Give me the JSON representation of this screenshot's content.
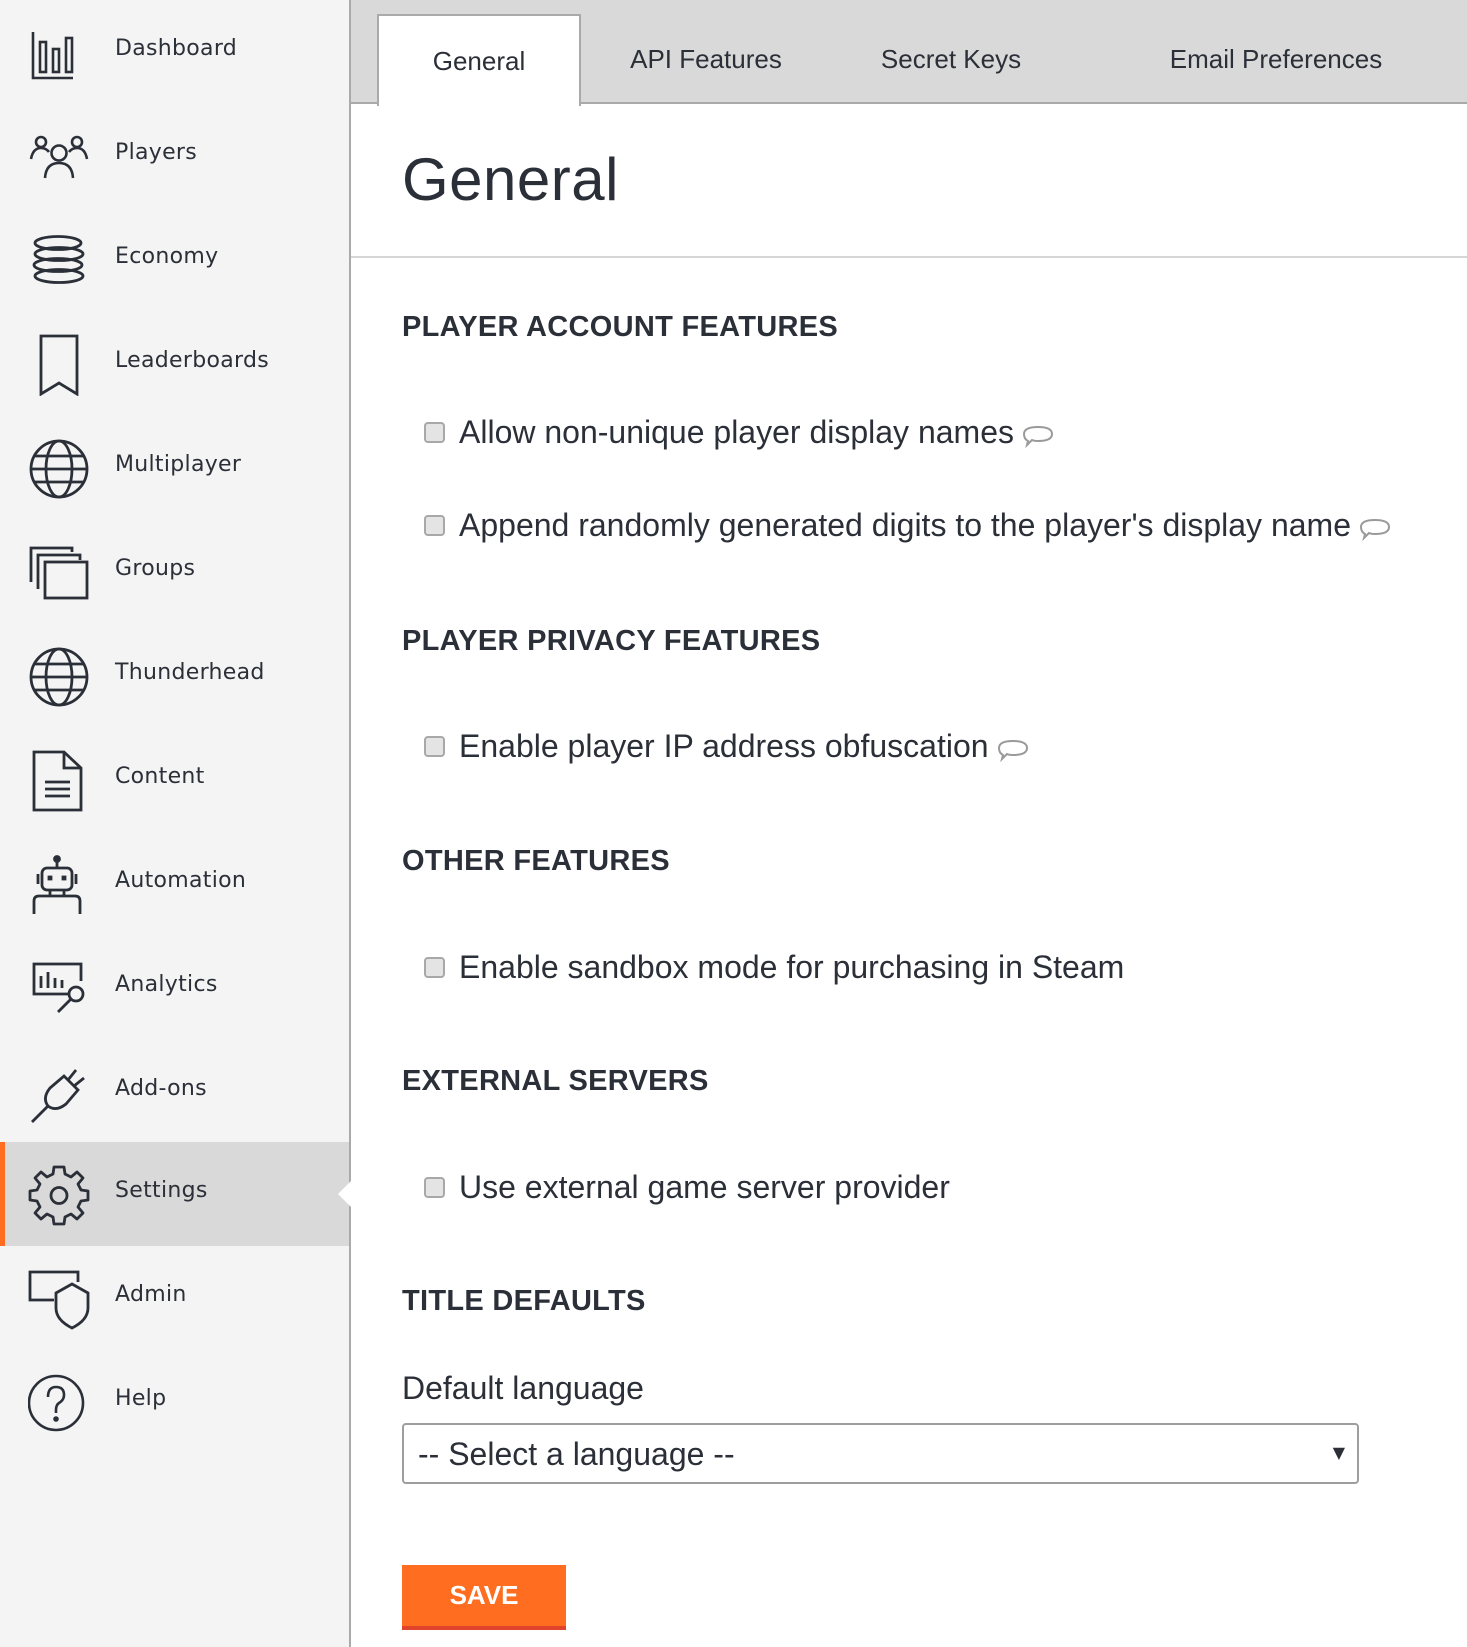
{
  "sidebar": {
    "items": [
      {
        "label": "Dashboard",
        "icon": "bar-chart-icon"
      },
      {
        "label": "Players",
        "icon": "players-icon"
      },
      {
        "label": "Economy",
        "icon": "coin-stack-icon"
      },
      {
        "label": "Leaderboards",
        "icon": "bookmark-icon"
      },
      {
        "label": "Multiplayer",
        "icon": "globe-icon"
      },
      {
        "label": "Groups",
        "icon": "stacked-windows-icon"
      },
      {
        "label": "Thunderhead",
        "icon": "globe-icon"
      },
      {
        "label": "Content",
        "icon": "document-icon"
      },
      {
        "label": "Automation",
        "icon": "robot-icon"
      },
      {
        "label": "Analytics",
        "icon": "analytics-search-icon"
      },
      {
        "label": "Add-ons",
        "icon": "plug-icon"
      },
      {
        "label": "Settings",
        "icon": "gear-icon",
        "active": true
      },
      {
        "label": "Admin",
        "icon": "admin-shield-icon"
      },
      {
        "label": "Help",
        "icon": "help-circle-icon"
      }
    ]
  },
  "tabs": [
    {
      "label": "General",
      "active": true
    },
    {
      "label": "API Features"
    },
    {
      "label": "Secret Keys"
    },
    {
      "label": "Email Preferences"
    }
  ],
  "page": {
    "title": "General",
    "sections": [
      {
        "heading": "PLAYER ACCOUNT FEATURES",
        "options": [
          {
            "label": "Allow non-unique player display names",
            "checked": false,
            "has_info": true
          },
          {
            "label": "Append randomly generated digits to the player's display name",
            "checked": false,
            "has_info": true
          }
        ]
      },
      {
        "heading": "PLAYER PRIVACY FEATURES",
        "options": [
          {
            "label": "Enable player IP address obfuscation",
            "checked": false,
            "has_info": true
          }
        ]
      },
      {
        "heading": "OTHER FEATURES",
        "options": [
          {
            "label": "Enable sandbox mode for purchasing in Steam",
            "checked": false,
            "has_info": false
          }
        ]
      },
      {
        "heading": "EXTERNAL SERVERS",
        "options": [
          {
            "label": "Use external game server provider",
            "checked": false,
            "has_info": false
          }
        ]
      },
      {
        "heading": "TITLE DEFAULTS"
      }
    ],
    "default_language": {
      "label": "Default language",
      "selected": "-- Select a language --",
      "arrow": "▼"
    },
    "save_label": "SAVE"
  },
  "colors": {
    "accent": "#ff6d21",
    "sidebar_bg": "#f4f4f4",
    "active_bg": "#d9d9d9",
    "text": "#2b2f38"
  }
}
